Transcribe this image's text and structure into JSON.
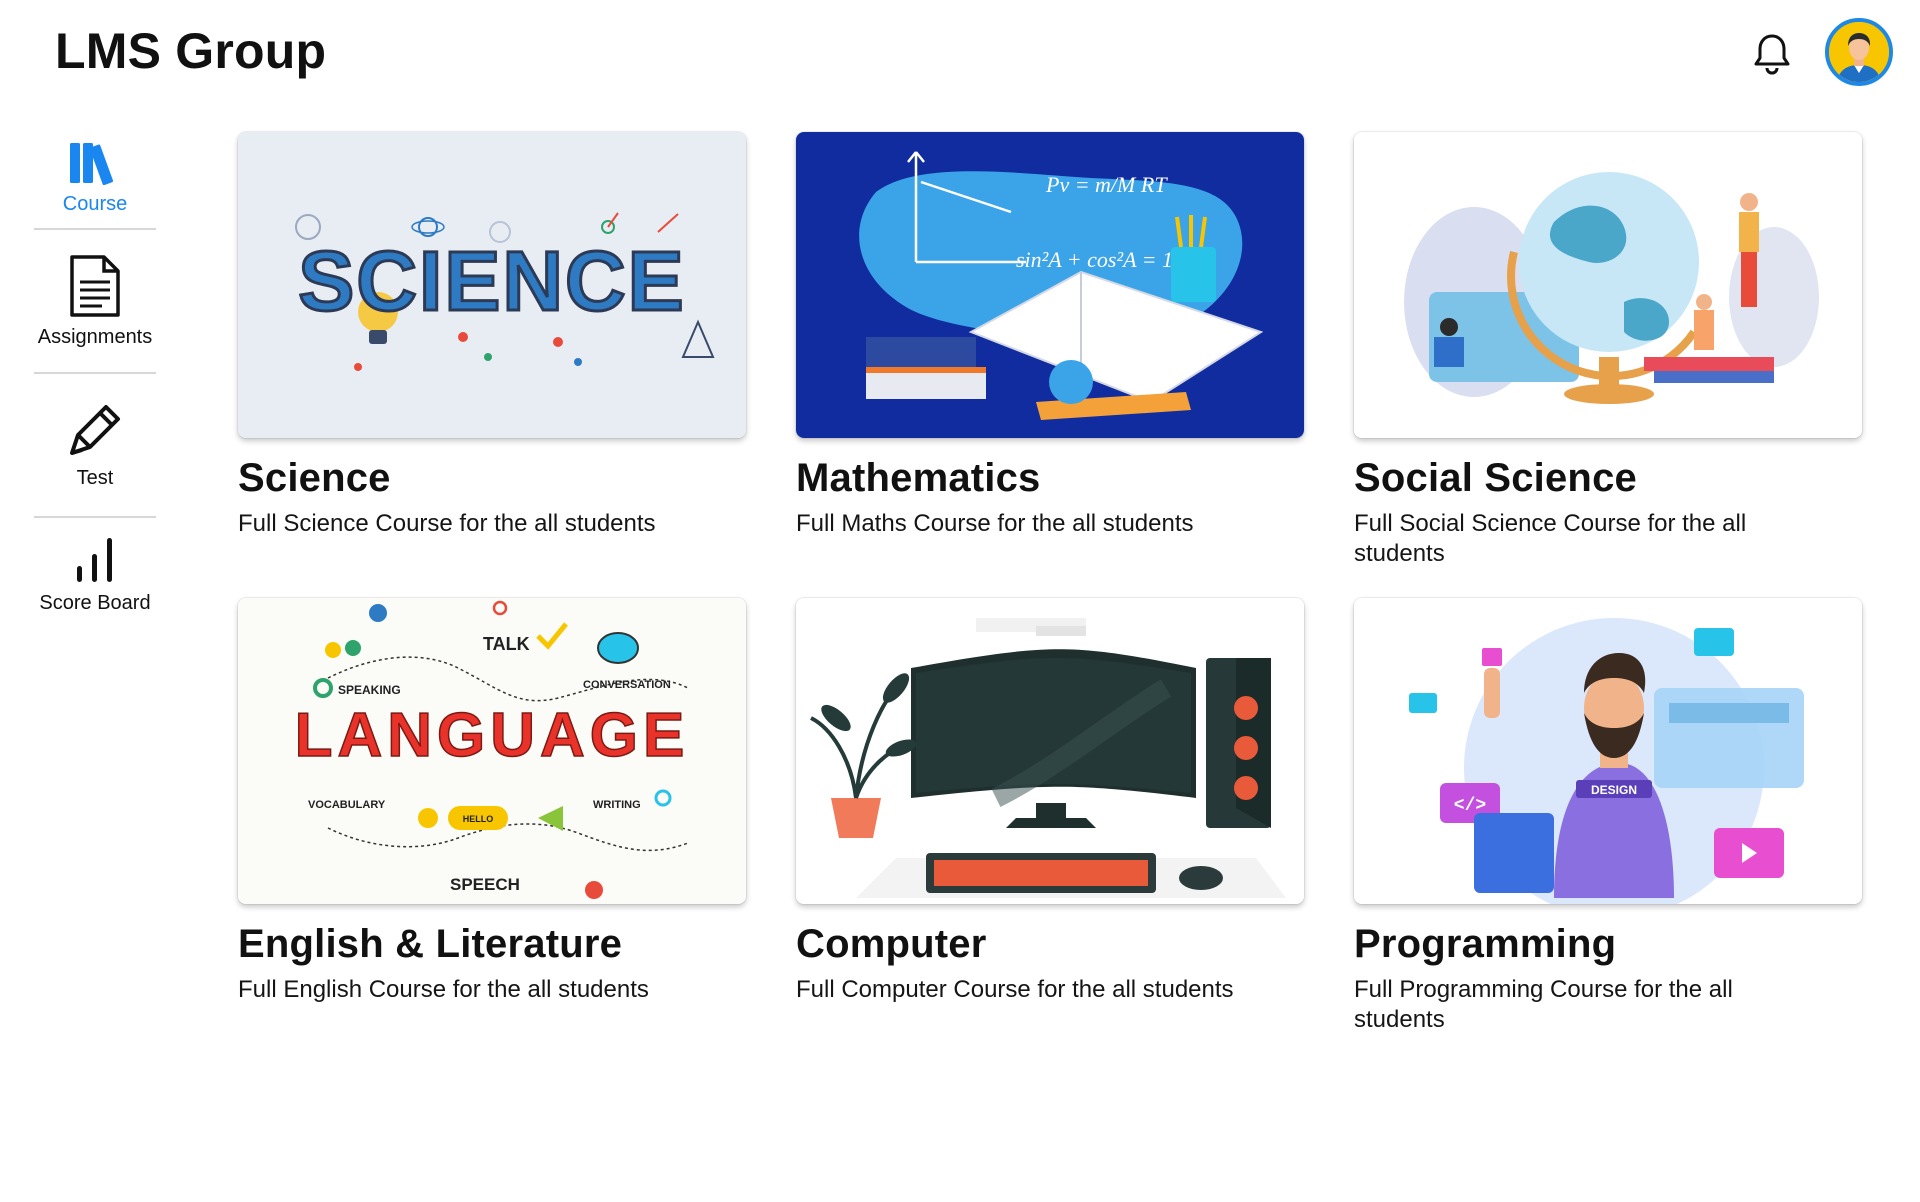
{
  "header": {
    "title": "LMS Group"
  },
  "sidebar": {
    "items": [
      {
        "label": "Course",
        "icon": "books-icon",
        "active": true
      },
      {
        "label": "Assignments",
        "icon": "document-icon",
        "active": false
      },
      {
        "label": "Test",
        "icon": "pen-icon",
        "active": false
      },
      {
        "label": "Score Board",
        "icon": "bar-chart-icon",
        "active": false
      }
    ]
  },
  "courses": [
    {
      "title": "Science",
      "description": "Full Science Course for the all students",
      "image": "science-illustration",
      "image_text": "SCIENCE"
    },
    {
      "title": "Mathematics",
      "description": "Full Maths Course for the all students",
      "image": "mathematics-illustration"
    },
    {
      "title": "Social Science",
      "description": "Full Social Science Course for the all students",
      "image": "social-science-illustration"
    },
    {
      "title": "English & Literature",
      "description": "Full English Course for the all students",
      "image": "language-illustration",
      "image_text": {
        "main": "LANGUAGE",
        "talk": "TALK",
        "speaking": "SPEAKING",
        "conversation": "CONVERSATION",
        "vocabulary": "VOCABULARY",
        "hello": "HELLO",
        "writing": "WRITING",
        "speech": "SPEECH"
      }
    },
    {
      "title": "Computer",
      "description": "Full Computer Course for the all students",
      "image": "computer-illustration"
    },
    {
      "title": "Programming",
      "description": "Full Programming Course for the all students",
      "image": "programming-illustration",
      "image_text": "DESIGN"
    }
  ],
  "colors": {
    "accent": "#1a86f0",
    "avatar_bg": "#f7c600",
    "avatar_ring": "#1d88e5"
  }
}
